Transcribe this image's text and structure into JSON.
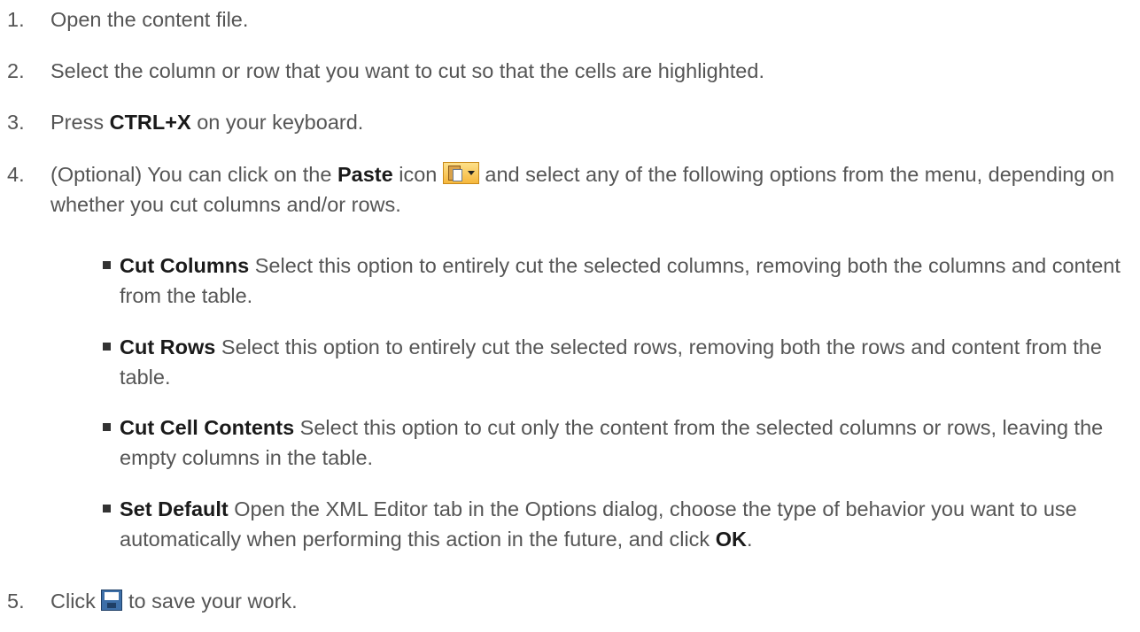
{
  "steps": [
    {
      "number": "1.",
      "text": "Open the content file."
    },
    {
      "number": "2.",
      "text": "Select the column or row that you want to cut so that the cells are highlighted."
    },
    {
      "number": "3.",
      "before": "Press ",
      "key": "CTRL+X",
      "after": " on your keyboard."
    },
    {
      "number": "4.",
      "before": "(Optional) You can click on the ",
      "strong": "Paste",
      "middle": " icon ",
      "icon": "paste-dropdown-icon",
      "after": " and select any of the following options from the menu, depending on whether you cut columns and/or rows.",
      "options": [
        {
          "name": "Cut Columns",
          "description": " Select this option to entirely cut the selected columns, removing both the columns and content from the table."
        },
        {
          "name": "Cut Rows",
          "description": " Select this option to entirely cut the selected rows, removing both the rows and content from the table."
        },
        {
          "name": "Cut Cell Contents",
          "description": " Select this option to cut only the content from the selected columns or rows, leaving the empty columns in the table."
        },
        {
          "name": "Set Default",
          "description": " Open the XML Editor tab in the Options dialog, choose the type of behavior you want to use automatically when performing this action in the future, and click ",
          "ok": "OK",
          "end": "."
        }
      ]
    },
    {
      "number": "5.",
      "before": "Click ",
      "icon": "save-icon",
      "after": " to save your work."
    }
  ]
}
